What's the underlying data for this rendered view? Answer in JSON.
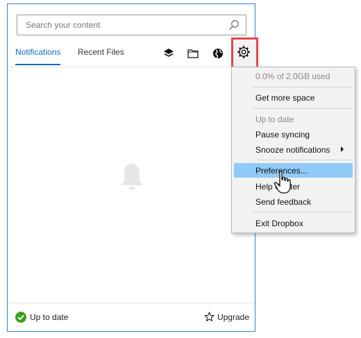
{
  "search": {
    "placeholder": "Search your content"
  },
  "tabs": [
    {
      "label": "Notifications",
      "active": true
    },
    {
      "label": "Recent Files",
      "active": false
    }
  ],
  "toolbar": {
    "icons": [
      "layers-icon",
      "folder-icon",
      "globe-icon",
      "gear-icon"
    ]
  },
  "footer": {
    "status": "Up to date",
    "upgrade_label": "Upgrade"
  },
  "menu": {
    "usage": "0.0% of 2.0GB used",
    "get_more_space": "Get more space",
    "sync_status": "Up to date",
    "pause_syncing": "Pause syncing",
    "snooze": "Snooze notifications",
    "preferences": "Preferences...",
    "help_center": "Help Center",
    "send_feedback": "Send feedback",
    "exit": "Exit Dropbox"
  },
  "colors": {
    "accent": "#0f6ec2",
    "highlight_box": "#e8454c",
    "menu_hover": "#91c9f7",
    "status_ok": "#3aa11c"
  }
}
